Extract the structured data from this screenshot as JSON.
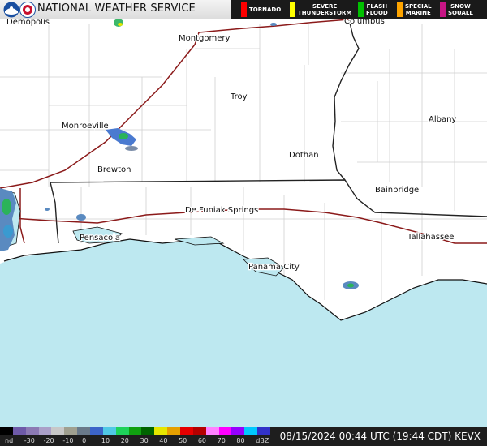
{
  "header": {
    "agency": "NATIONAL WEATHER SERVICE",
    "legend": [
      {
        "label": "TORNADO",
        "color": "#ff0000"
      },
      {
        "label": "SEVERE\nTHUNDERSTORM",
        "color": "#ffff00"
      },
      {
        "label": "FLASH\nFLOOD",
        "color": "#00c000"
      },
      {
        "label": "SPECIAL\nMARINE",
        "color": "#ffa500"
      },
      {
        "label": "SNOW\nSQUALL",
        "color": "#c71585"
      }
    ]
  },
  "cities": [
    {
      "name": "Demopolis"
    },
    {
      "name": "Montgomery"
    },
    {
      "name": "Columbus"
    },
    {
      "name": "Troy"
    },
    {
      "name": "Albany"
    },
    {
      "name": "Monroeville"
    },
    {
      "name": "Dothan"
    },
    {
      "name": "Brewton"
    },
    {
      "name": "Bainbridge"
    },
    {
      "name": "De Funiak Springs"
    },
    {
      "name": "Pensacola"
    },
    {
      "name": "Tallahassee"
    },
    {
      "name": "Panama City"
    }
  ],
  "footer": {
    "scale_labels": [
      "nd",
      "-30",
      "-20",
      "-10",
      "0",
      "10",
      "20",
      "30",
      "40",
      "50",
      "60",
      "70",
      "80",
      "dBZ"
    ],
    "scale_colors": [
      "#000000",
      "#6e5aa8",
      "#8c7ab4",
      "#aaa0c8",
      "#c8c8c8",
      "#a0a090",
      "#6a7a8a",
      "#3c64c8",
      "#50c8e6",
      "#1ed25a",
      "#10a010",
      "#006400",
      "#e6e600",
      "#e6a000",
      "#e60000",
      "#b40000",
      "#ff80ff",
      "#ff00ff",
      "#9600ff",
      "#00c8ff",
      "#3232c8"
    ],
    "timestamp": "08/15/2024 00:44 UTC (19:44 CDT)",
    "station": "KEVX"
  }
}
